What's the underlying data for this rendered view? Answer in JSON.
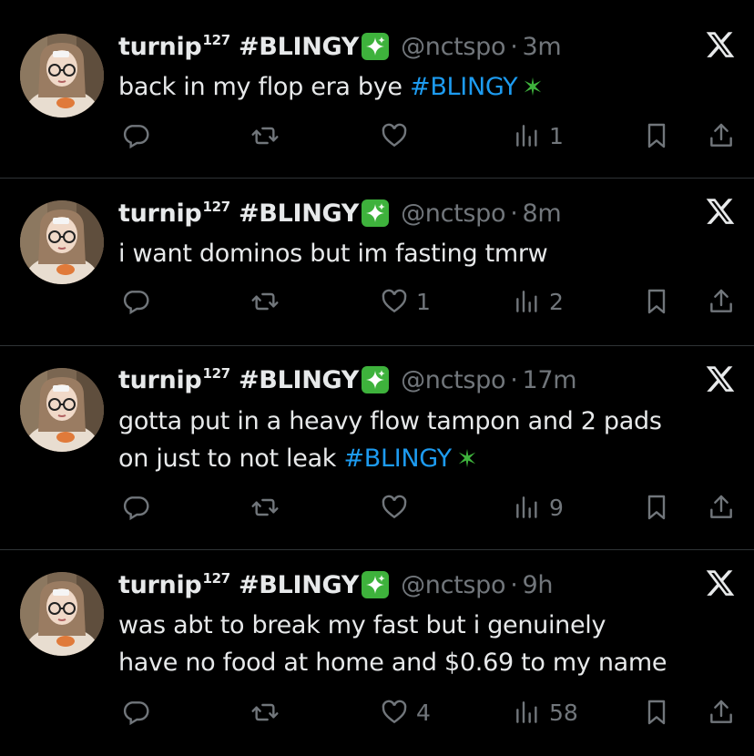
{
  "tweets": [
    {
      "display_name": "turnip",
      "name_sup": "127",
      "name_tag": "#BLINGY",
      "handle": "@nctspo",
      "separator": "·",
      "time": "3m",
      "text_plain": "back in my flop era bye ",
      "text_hashtag": "#BLINGY",
      "text_line2": "",
      "text_line2_hashtag": "",
      "likes": "",
      "views": "1"
    },
    {
      "display_name": "turnip",
      "name_sup": "127",
      "name_tag": "#BLINGY",
      "handle": "@nctspo",
      "separator": "·",
      "time": "8m",
      "text_plain": "i want dominos but im fasting tmrw",
      "text_hashtag": "",
      "text_line2": "",
      "text_line2_hashtag": "",
      "likes": "1",
      "views": "2"
    },
    {
      "display_name": "turnip",
      "name_sup": "127",
      "name_tag": "#BLINGY",
      "handle": "@nctspo",
      "separator": "·",
      "time": "17m",
      "text_plain": "gotta put in a heavy flow tampon and 2 pads",
      "text_hashtag": "",
      "text_line2": "on just to not leak ",
      "text_line2_hashtag": "#BLINGY",
      "likes": "",
      "views": "9"
    },
    {
      "display_name": "turnip",
      "name_sup": "127",
      "name_tag": "#BLINGY",
      "handle": "@nctspo",
      "separator": "·",
      "time": "9h",
      "text_plain": "was abt to break my fast but i genuinely",
      "text_hashtag": "",
      "text_line2": "have no food at home and $0.69 to my name",
      "text_line2_hashtag": "",
      "likes": "4",
      "views": "58"
    }
  ],
  "icons": {
    "reply": "reply-icon",
    "retweet": "retweet-icon",
    "like": "heart-icon",
    "views": "views-icon",
    "bookmark": "bookmark-icon",
    "share": "share-icon",
    "platform": "x-logo-icon",
    "badge": "sparkle-icon"
  },
  "colors": {
    "background": "#000000",
    "text": "#e7e9ea",
    "muted": "#71767b",
    "hashtag": "#1d9bf0",
    "badge": "#3eb23c",
    "divider": "#2f3336"
  }
}
